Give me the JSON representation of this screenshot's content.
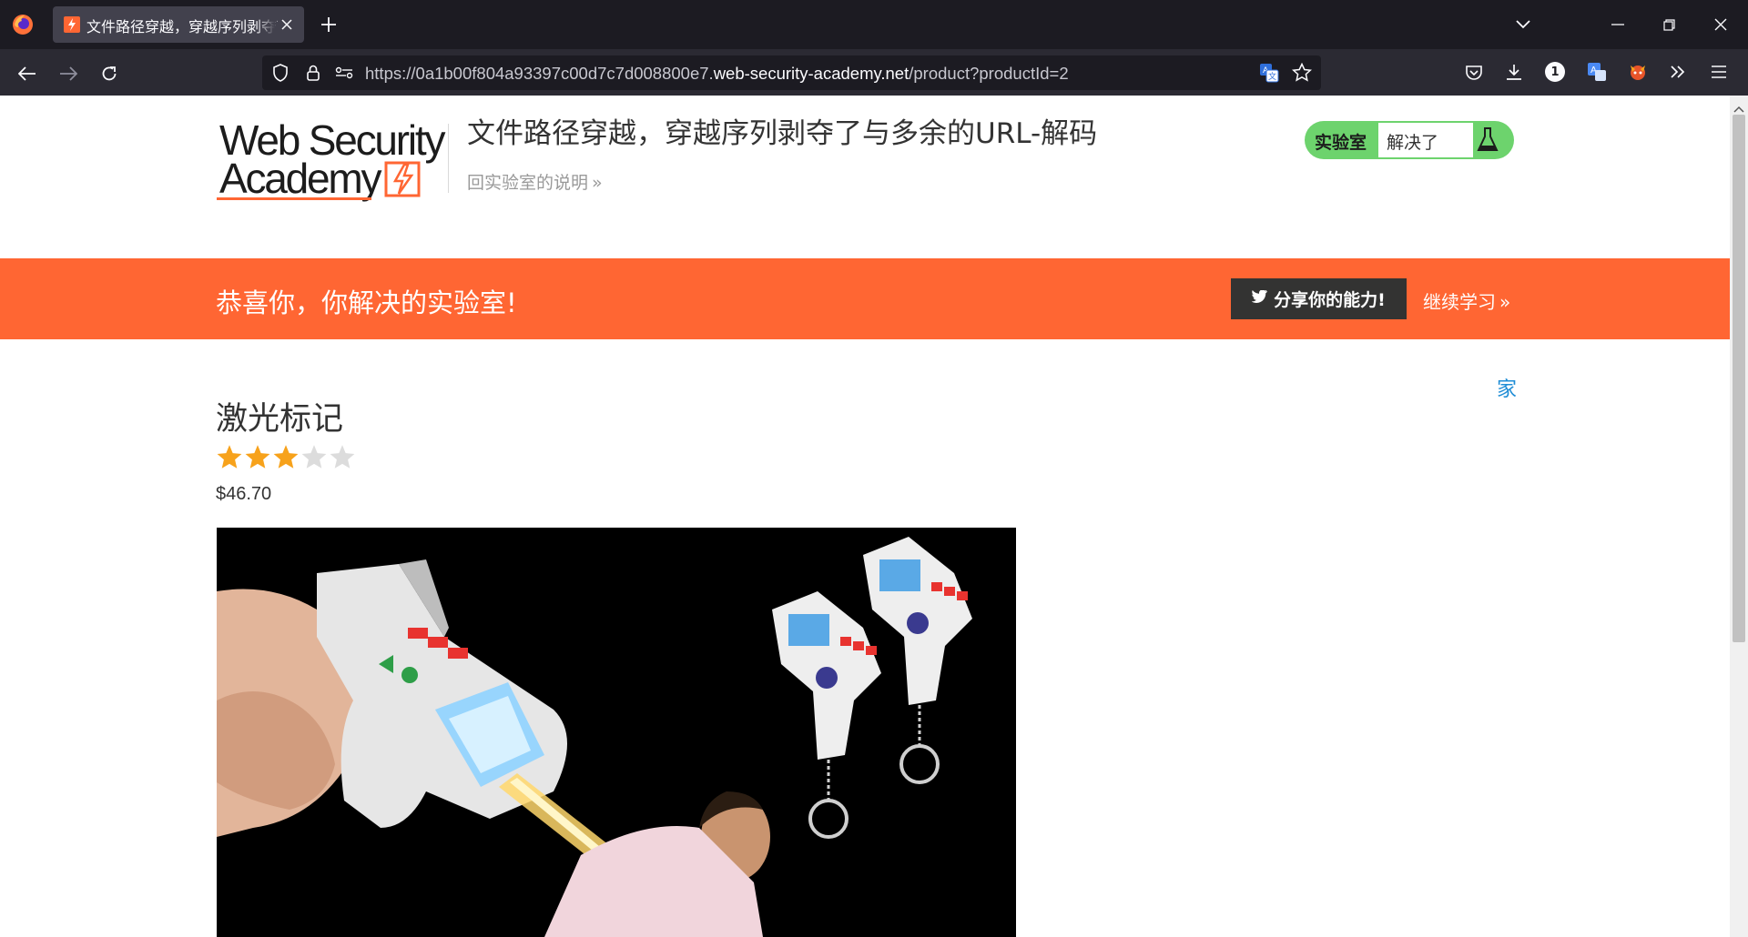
{
  "browser": {
    "tab": {
      "title": "文件路径穿越，穿越序列剥夺了与多余的URL-解码"
    },
    "url": {
      "prefix": "https://0a1b00f804a93397c00d7c7d008800e7.",
      "domain": "web-security-academy.net",
      "path": "/product?productId=2"
    },
    "extension_badge": "1"
  },
  "site": {
    "logo": {
      "line1": "Web Security",
      "line2": "Academy"
    },
    "lab_title": "文件路径穿越，穿越序列剥夺了与多余的URL-解码",
    "back_link": "回实验室的说明",
    "status": {
      "label": "实验室",
      "value": "解决了"
    }
  },
  "banner": {
    "message": "恭喜你，你解决的实验室!",
    "share_label": "分享你的能力!",
    "continue_label": "继续学习"
  },
  "nav": {
    "home_label": "家"
  },
  "product": {
    "name": "激光标记",
    "rating": 3,
    "rating_max": 5,
    "price": "$46.70"
  },
  "colors": {
    "accent": "#ff6633",
    "status_green": "#6dd36d",
    "link_blue": "#1f8dd6",
    "star_gold": "#f7a21b",
    "star_empty": "#dcdcdc"
  }
}
